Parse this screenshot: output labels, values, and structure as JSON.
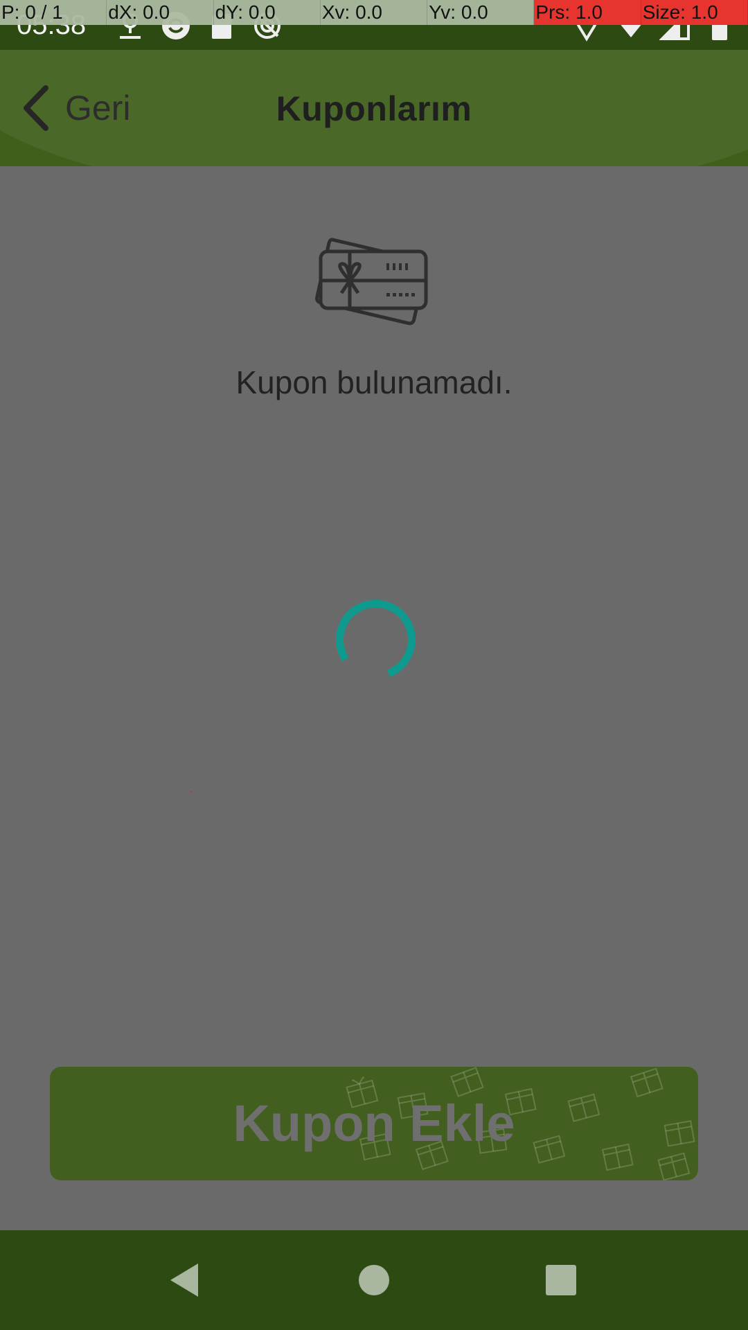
{
  "debug": {
    "cells": [
      "P: 0 / 1",
      "dX: 0.0",
      "dY: 0.0",
      "Xv: 0.0",
      "Yv: 0.0",
      "Prs: 1.0",
      "Size: 1.0"
    ]
  },
  "status_bar": {
    "time": "05:38",
    "left_icons": [
      "download-icon",
      "sync-icon",
      "sd-card-icon",
      "no-location-icon"
    ],
    "right_icons": [
      "location-pin-icon",
      "wifi-icon",
      "signal-icon",
      "battery-icon"
    ]
  },
  "header": {
    "back_label": "Geri",
    "title": "Kuponlarım"
  },
  "content": {
    "empty_icon": "coupon-card-icon",
    "empty_message": "Kupon bulunamadı."
  },
  "add_button": {
    "label": "Kupon Ekle"
  },
  "nav": {
    "buttons": [
      "back-triangle-icon",
      "home-circle-icon",
      "recents-square-icon"
    ]
  },
  "colors": {
    "overlay": "#6a6a6a",
    "header": "#3f5f1a",
    "status_bar": "#2d4a13",
    "button": "#435f1f",
    "spinner": "#0e9a8e"
  }
}
